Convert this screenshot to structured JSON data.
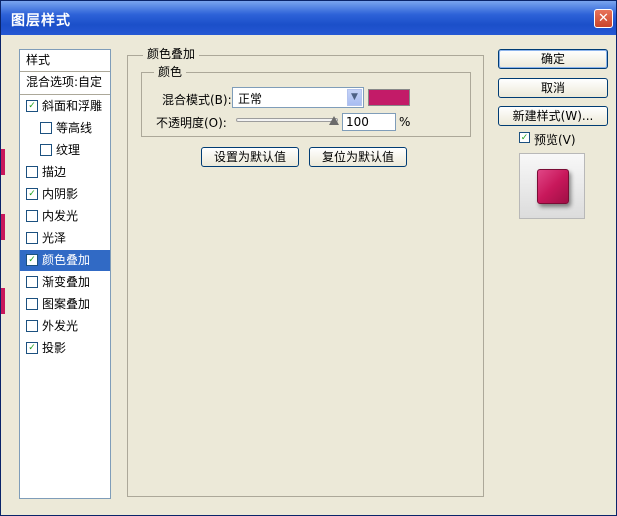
{
  "window": {
    "title": "图层样式",
    "close_glyph": "✕"
  },
  "sidebar": {
    "header": "样式",
    "blend_options": "混合选项:自定",
    "items": [
      {
        "label": "斜面和浮雕",
        "checked": true,
        "indent": false,
        "selected": false
      },
      {
        "label": "等高线",
        "checked": false,
        "indent": true,
        "selected": false
      },
      {
        "label": "纹理",
        "checked": false,
        "indent": true,
        "selected": false
      },
      {
        "label": "描边",
        "checked": false,
        "indent": false,
        "selected": false
      },
      {
        "label": "内阴影",
        "checked": true,
        "indent": false,
        "selected": false
      },
      {
        "label": "内发光",
        "checked": false,
        "indent": false,
        "selected": false
      },
      {
        "label": "光泽",
        "checked": false,
        "indent": false,
        "selected": false
      },
      {
        "label": "颜色叠加",
        "checked": true,
        "indent": false,
        "selected": true
      },
      {
        "label": "渐变叠加",
        "checked": false,
        "indent": false,
        "selected": false
      },
      {
        "label": "图案叠加",
        "checked": false,
        "indent": false,
        "selected": false
      },
      {
        "label": "外发光",
        "checked": false,
        "indent": false,
        "selected": false
      },
      {
        "label": "投影",
        "checked": true,
        "indent": false,
        "selected": false
      }
    ]
  },
  "panel": {
    "title": "颜色叠加",
    "group_title": "颜色",
    "blend_mode_label": "混合模式(B):",
    "blend_mode_value": "正常",
    "overlay_color": "#c31b68",
    "opacity_label": "不透明度(O):",
    "opacity_value": "100",
    "opacity_unit": "%",
    "opacity_level": 1.0,
    "set_default_label": "设置为默认值",
    "reset_default_label": "复位为默认值"
  },
  "actions": {
    "ok_label": "确定",
    "cancel_label": "取消",
    "new_style_label": "新建样式(W)...",
    "preview_label": "预览(V)",
    "preview_checked": true
  },
  "colors": {
    "titlebar": "#2d62d8",
    "selection": "#316ac5",
    "accent_magenta": "#c8185b"
  }
}
